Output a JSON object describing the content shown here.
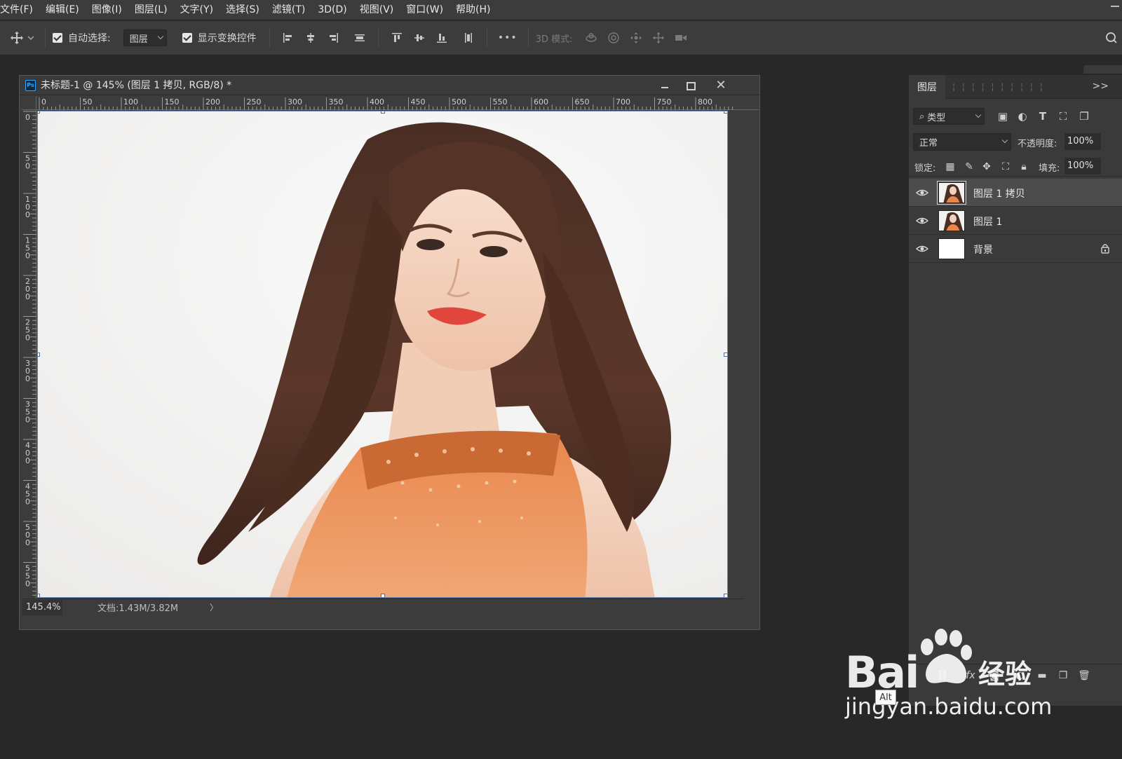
{
  "menubar": {
    "items": [
      "文件(F)",
      "编辑(E)",
      "图像(I)",
      "图层(L)",
      "文字(Y)",
      "选择(S)",
      "滤镜(T)",
      "3D(D)",
      "视图(V)",
      "窗口(W)",
      "帮助(H)"
    ]
  },
  "options": {
    "auto_select_label": "自动选择:",
    "auto_select_checked": true,
    "auto_select_target": "图层",
    "show_transform_label": "显示变换控件",
    "show_transform_checked": true,
    "more_label": "•••",
    "mode_3d_label": "3D 模式:"
  },
  "document": {
    "title": "未标题-1 @ 145% (图层 1 拷贝, RGB/8) *",
    "app_badge": "Ps",
    "h_ruler_labels": [
      "0",
      "50",
      "100",
      "150",
      "200",
      "250",
      "300",
      "350",
      "400",
      "450",
      "500",
      "550",
      "600",
      "650",
      "700",
      "750",
      "800"
    ],
    "v_ruler_labels": [
      "0",
      "50",
      "100",
      "150",
      "200",
      "250",
      "300",
      "350",
      "400",
      "450",
      "500",
      "550"
    ],
    "zoom": "145.4%",
    "doc_info": "文档:1.43M/3.82M",
    "status_arrow": "〉"
  },
  "layers_panel": {
    "tab_label": "图层",
    "tab_more": ">>",
    "filter_label": "类型",
    "blend_mode": "正常",
    "opacity_label": "不透明度:",
    "opacity_value": "100%",
    "lock_label": "锁定:",
    "fill_label": "填充:",
    "fill_value": "100%",
    "layers": [
      {
        "name": "图层 1 拷贝",
        "visible": true,
        "selected": true,
        "thumb": "photo"
      },
      {
        "name": "图层 1",
        "visible": true,
        "selected": false,
        "thumb": "photo"
      },
      {
        "name": "背景",
        "visible": true,
        "selected": false,
        "thumb": "white",
        "locked": true
      }
    ]
  },
  "watermark": {
    "logo": "Bai",
    "logo_suffix": "经验",
    "url": "jingyan.baidu.com"
  },
  "tooltip": {
    "text": "Alt"
  },
  "colors": {
    "ui_bg": "#282828",
    "panel_bg": "#3a3a3a",
    "bar_bg": "#3c3c3c",
    "accent_blue": "#31a8ff"
  }
}
